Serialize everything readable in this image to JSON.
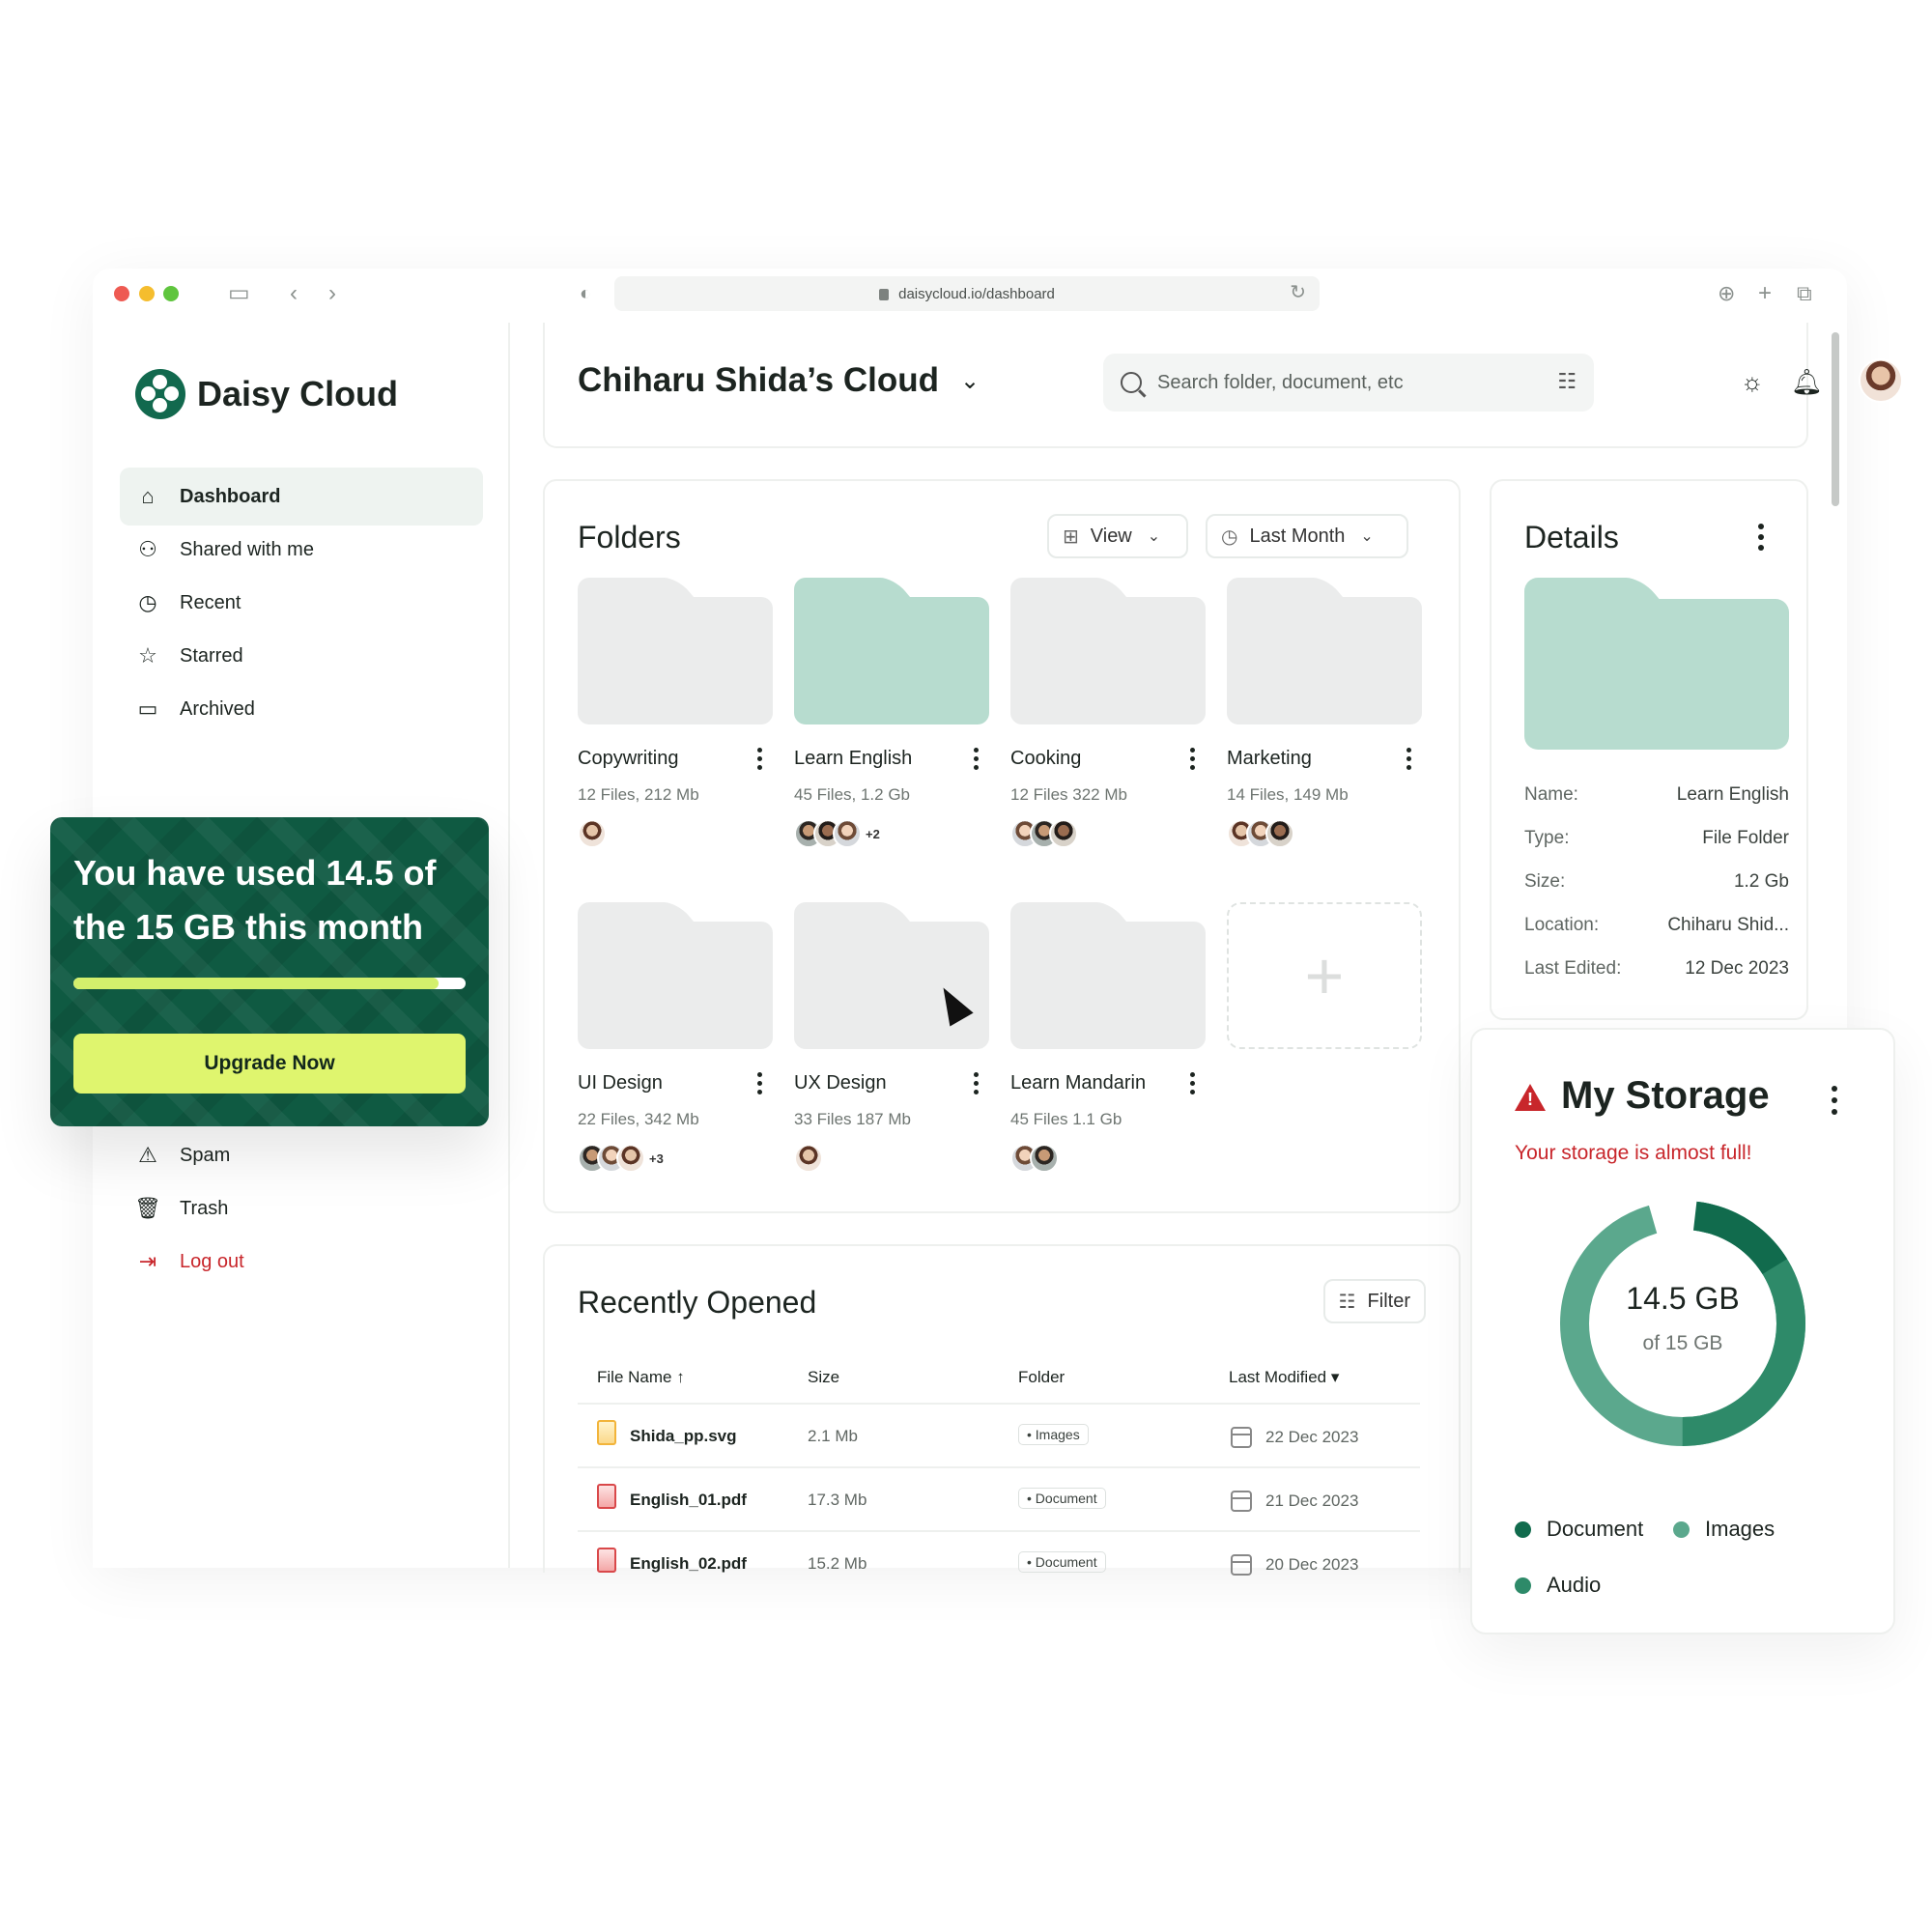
{
  "browser": {
    "url": "daisycloud.io/dashboard"
  },
  "app": {
    "name": "Daisy Cloud",
    "brand_color": "#12694E",
    "accent_color": "#DFF56E",
    "danger_color": "#C8262B"
  },
  "sidebar": {
    "items": [
      {
        "label": "Dashboard",
        "icon": "home-icon",
        "active": true
      },
      {
        "label": "Shared with me",
        "icon": "people-icon"
      },
      {
        "label": "Recent",
        "icon": "clock-icon"
      },
      {
        "label": "Starred",
        "icon": "star-icon"
      },
      {
        "label": "Archived",
        "icon": "archive-icon"
      }
    ],
    "bottom_items": [
      {
        "label": "Spam",
        "icon": "warning-icon"
      },
      {
        "label": "Trash",
        "icon": "trash-icon"
      },
      {
        "label": "Log out",
        "icon": "logout-icon"
      }
    ]
  },
  "usage": {
    "text": "You have used 14.5 of the 15 GB this month",
    "used_fraction": 0.93,
    "button": "Upgrade Now"
  },
  "header": {
    "title": "Chiharu Shida’s Cloud",
    "search_placeholder": "Search folder, document, etc"
  },
  "folders": {
    "title": "Folders",
    "view_label": "View",
    "period_label": "Last Month",
    "items": [
      {
        "name": "Copywriting",
        "meta": "12 Files, 212 Mb",
        "avatars": 1,
        "extra": ""
      },
      {
        "name": "Learn English",
        "meta": "45 Files, 1.2 Gb",
        "avatars": 3,
        "extra": "+2",
        "selected": true
      },
      {
        "name": "Cooking",
        "meta": "12 Files 322 Mb",
        "avatars": 3,
        "extra": ""
      },
      {
        "name": "Marketing",
        "meta": "14 Files, 149 Mb",
        "avatars": 3,
        "extra": ""
      },
      {
        "name": "UI Design",
        "meta": "22 Files, 342 Mb",
        "avatars": 3,
        "extra": "+3"
      },
      {
        "name": "UX Design",
        "meta": "33 Files 187 Mb",
        "avatars": 1,
        "extra": ""
      },
      {
        "name": "Learn Mandarin",
        "meta": "45 Files 1.1 Gb",
        "avatars": 2,
        "extra": ""
      }
    ]
  },
  "details": {
    "title": "Details",
    "rows": [
      {
        "key": "Name:",
        "value": "Learn English"
      },
      {
        "key": "Type:",
        "value": "File Folder"
      },
      {
        "key": "Size:",
        "value": "1.2 Gb"
      },
      {
        "key": "Location:",
        "value": "Chiharu Shid..."
      },
      {
        "key": "Last Edited:",
        "value": "12 Dec 2023"
      }
    ]
  },
  "recent": {
    "title": "Recently Opened",
    "filter_label": "Filter",
    "columns": [
      "File Name",
      "Size",
      "Folder",
      "Last Modified"
    ],
    "rows": [
      {
        "name": "Shida_pp.svg",
        "type": "svg",
        "size": "2.1 Mb",
        "folder": "• Images",
        "date": "22 Dec 2023"
      },
      {
        "name": "English_01.pdf",
        "type": "pdf",
        "size": "17.3 Mb",
        "folder": "• Document",
        "date": "21 Dec 2023"
      },
      {
        "name": "English_02.pdf",
        "type": "pdf",
        "size": "15.2 Mb",
        "folder": "• Document",
        "date": "20 Dec 2023"
      }
    ]
  },
  "storage": {
    "title": "My Storage",
    "warning": "Your storage is almost full!",
    "used": "14.5 GB",
    "total": "of 15 GB",
    "legend": [
      {
        "label": "Document",
        "color": "#116B4D"
      },
      {
        "label": "Images",
        "color": "#5BA88D"
      },
      {
        "label": "Audio",
        "color": "#2E8A69"
      }
    ]
  }
}
